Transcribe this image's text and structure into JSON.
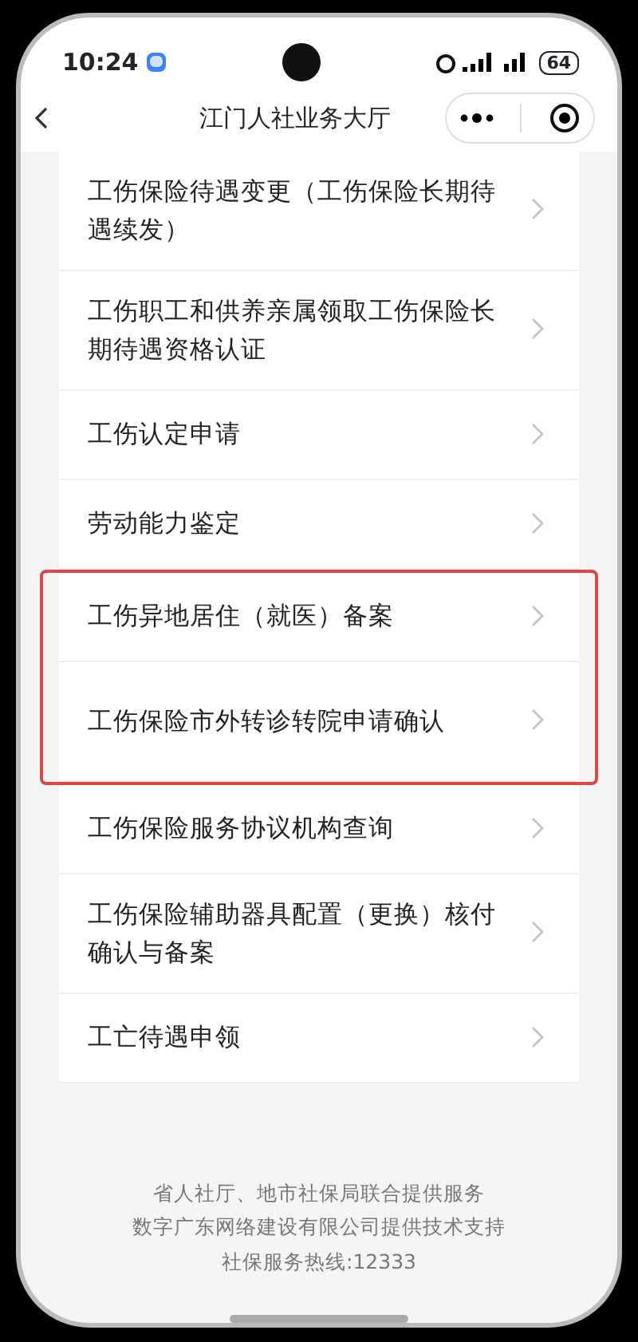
{
  "status_bar": {
    "time": "10:24",
    "battery": "64"
  },
  "nav_bar": {
    "title": "江门人社业务大厅"
  },
  "items": [
    {
      "label": "工伤保险待遇变更（工伤保险长期待遇续发）",
      "highlighted": false
    },
    {
      "label": "工伤职工和供养亲属领取工伤保险长期待遇资格认证",
      "highlighted": false
    },
    {
      "label": "工伤认定申请",
      "highlighted": false
    },
    {
      "label": "劳动能力鉴定",
      "highlighted": false
    },
    {
      "label": "工伤异地居住（就医）备案",
      "highlighted": true
    },
    {
      "label": "工伤保险市外转诊转院申请确认",
      "highlighted": true
    },
    {
      "label": "工伤保险服务协议机构查询",
      "highlighted": false
    },
    {
      "label": "工伤保险辅助器具配置（更换）核付确认与备案",
      "highlighted": false
    },
    {
      "label": "工亡待遇申领",
      "highlighted": false
    }
  ],
  "footer": [
    "省人社厅、地市社保局联合提供服务",
    "数字广东网络建设有限公司提供技术支持",
    "社保服务热线:12333"
  ]
}
